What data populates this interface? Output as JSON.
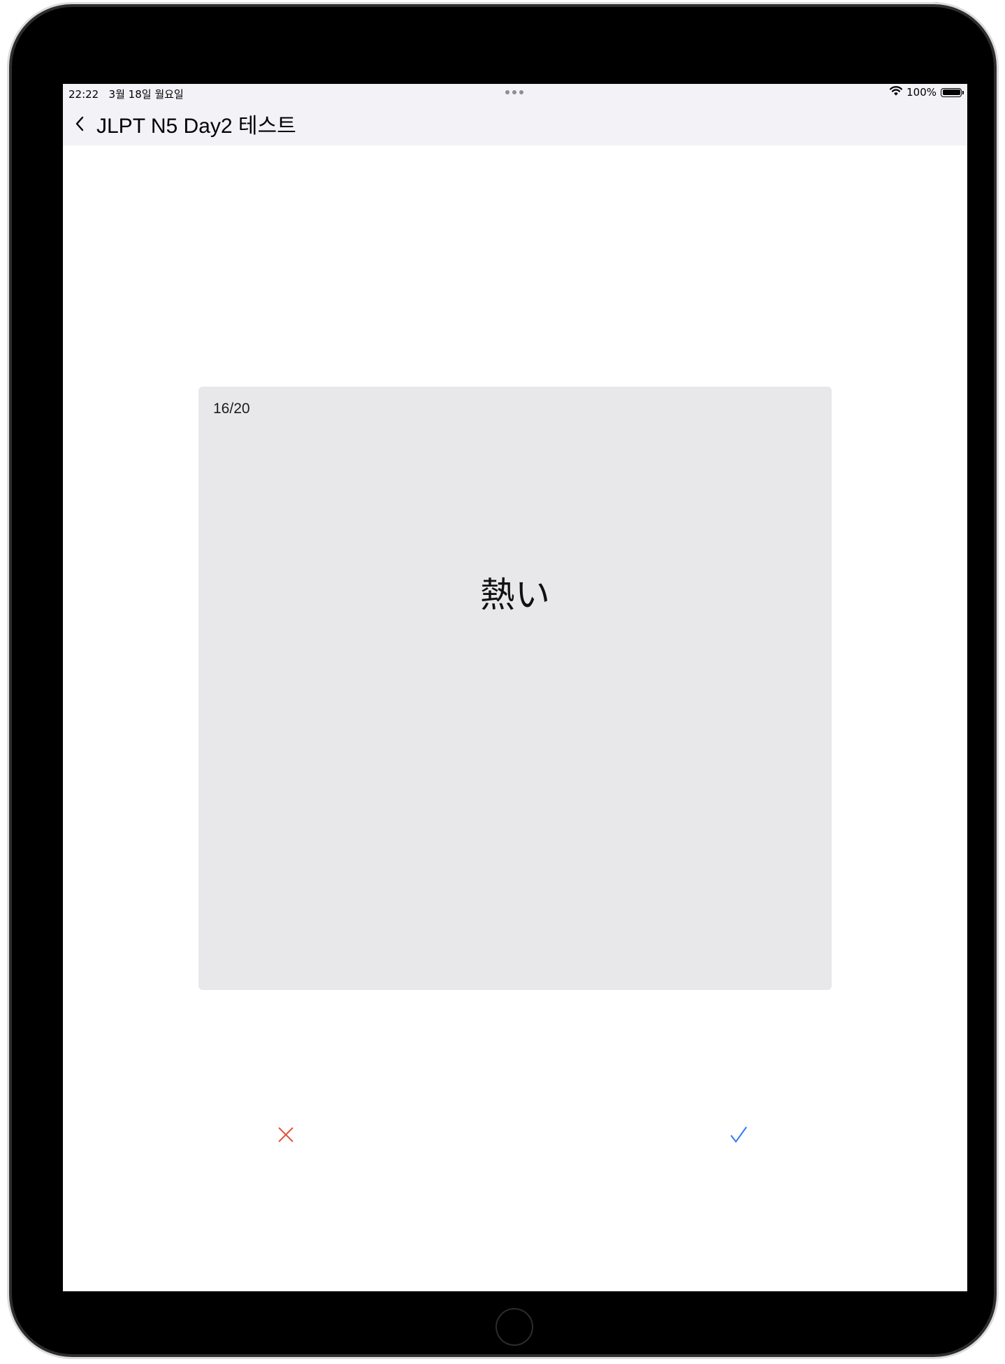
{
  "status_bar": {
    "time": "22:22",
    "date": "3월 18일 월요일",
    "battery_percent": "100%",
    "battery_level": 1.0
  },
  "nav": {
    "back_icon": "chevron-left-icon",
    "title": "JLPT N5 Day2 테스트"
  },
  "card": {
    "counter": "16/20",
    "word": "熱い"
  },
  "actions": {
    "wrong_icon": "x-mark-icon",
    "wrong_color": "#e5533d",
    "right_icon": "checkmark-icon",
    "right_color": "#3478f6"
  },
  "colors": {
    "topbar_bg": "#f2f2f7",
    "card_bg": "#e8e8ea"
  }
}
